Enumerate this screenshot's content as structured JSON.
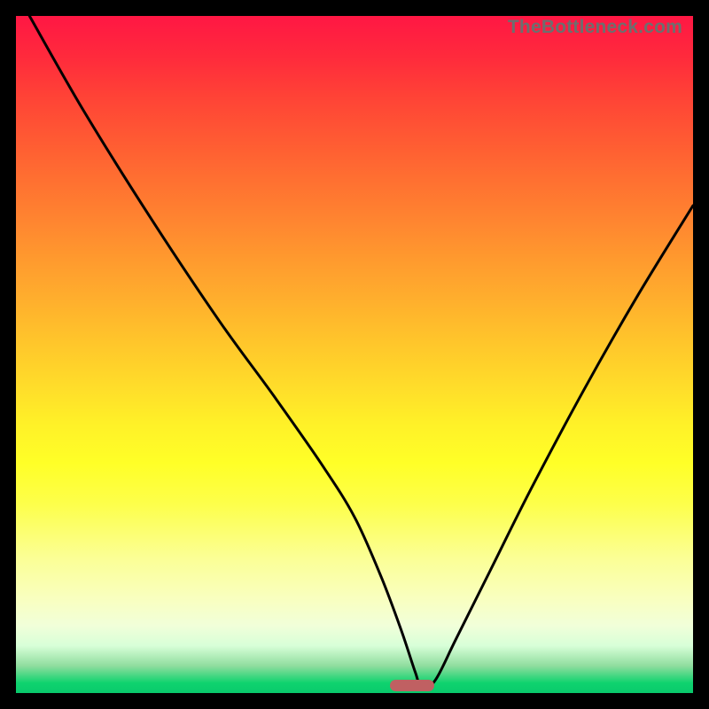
{
  "watermark_text": "TheBottleneck.com",
  "chart_data": {
    "type": "line",
    "title": "",
    "xlabel": "",
    "ylabel": "",
    "xlim": [
      0,
      100
    ],
    "ylim": [
      0,
      100
    ],
    "series": [
      {
        "name": "bottleneck-curve",
        "x": [
          2,
          10,
          20,
          30,
          38,
          45,
          50,
          54,
          57,
          59,
          60,
          62,
          65,
          70,
          76,
          84,
          92,
          100
        ],
        "values": [
          100,
          86,
          70,
          55,
          44,
          34,
          26,
          17,
          9,
          3,
          0.5,
          2,
          8,
          18,
          30,
          45,
          59,
          72
        ]
      }
    ],
    "marker": {
      "x": 58.5,
      "width": 6.5,
      "y": 0.2,
      "height": 1.8,
      "color": "#c06062"
    },
    "gradient_stops": [
      {
        "pct": 0,
        "color": "#ff1744"
      },
      {
        "pct": 50,
        "color": "#ffc52b"
      },
      {
        "pct": 78,
        "color": "#fbff95"
      },
      {
        "pct": 100,
        "color": "#09c96c"
      }
    ]
  }
}
